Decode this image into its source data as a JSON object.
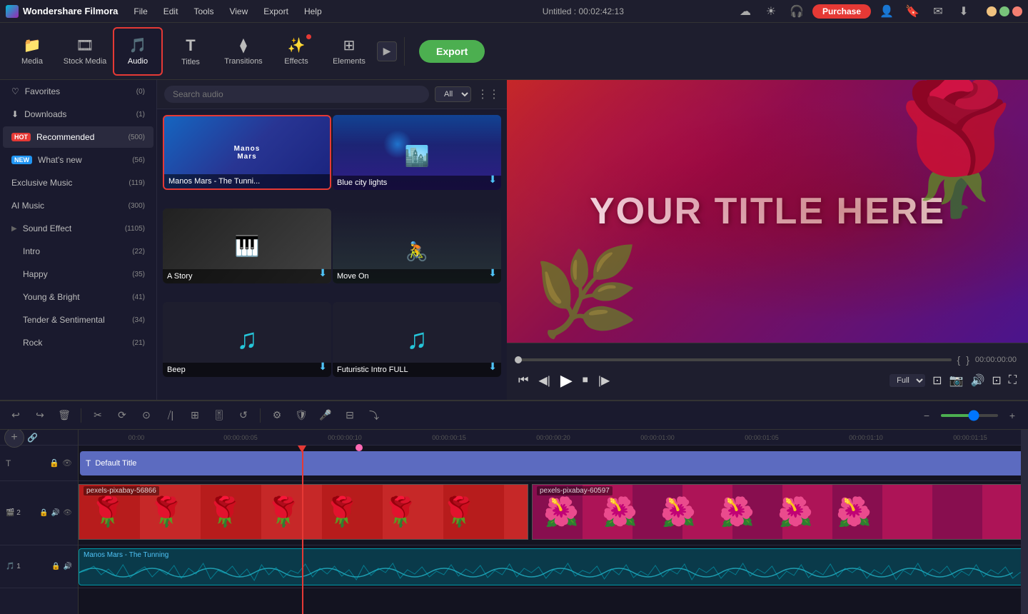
{
  "app": {
    "name": "Wondershare Filmora",
    "title": "Untitled : 00:02:42:13",
    "logo_icon": "🎬"
  },
  "titlebar": {
    "menu": [
      "File",
      "Edit",
      "Tools",
      "View",
      "Export",
      "Help"
    ],
    "purchase_label": "Purchase",
    "win_controls": [
      "minimize",
      "maximize",
      "close"
    ]
  },
  "toolbar": {
    "buttons": [
      {
        "id": "media",
        "label": "Media",
        "icon": "📁"
      },
      {
        "id": "stock",
        "label": "Stock Media",
        "icon": "🎞"
      },
      {
        "id": "audio",
        "label": "Audio",
        "icon": "🎵"
      },
      {
        "id": "titles",
        "label": "Titles",
        "icon": "T"
      },
      {
        "id": "transitions",
        "label": "Transitions",
        "icon": "⧫"
      },
      {
        "id": "effects",
        "label": "Effects",
        "icon": "✨"
      },
      {
        "id": "elements",
        "label": "Elements",
        "icon": "⊞"
      }
    ],
    "export_label": "Export"
  },
  "sidebar": {
    "items": [
      {
        "id": "favorites",
        "label": "Favorites",
        "count": "(0)",
        "icon": "♡"
      },
      {
        "id": "downloads",
        "label": "Downloads",
        "count": "(1)",
        "icon": "⬇"
      },
      {
        "id": "recommended",
        "label": "Recommended",
        "count": "(500)",
        "badge": "HOT"
      },
      {
        "id": "whatsnew",
        "label": "What's new",
        "count": "(56)",
        "badge": "NEW"
      },
      {
        "id": "exclusive",
        "label": "Exclusive Music",
        "count": "(119)"
      },
      {
        "id": "aimusic",
        "label": "AI Music",
        "count": "(300)"
      },
      {
        "id": "soundeffect",
        "label": "Sound Effect",
        "count": "(1105)",
        "hasArrow": true
      },
      {
        "id": "intro",
        "label": "Intro",
        "count": "(22)",
        "sub": true
      },
      {
        "id": "happy",
        "label": "Happy",
        "count": "(35)",
        "sub": true
      },
      {
        "id": "youngbright",
        "label": "Young & Bright",
        "count": "(41)",
        "sub": true
      },
      {
        "id": "tendersenti",
        "label": "Tender & Sentimental",
        "count": "(34)",
        "sub": true
      },
      {
        "id": "rock",
        "label": "Rock",
        "count": "(21)",
        "sub": true
      }
    ]
  },
  "audio_panel": {
    "search_placeholder": "Search audio",
    "filter_label": "All",
    "cards": [
      {
        "id": "manos",
        "label": "Manos Mars - The Tunni...",
        "type": "themed",
        "selected": true
      },
      {
        "id": "blue_city",
        "label": "Blue city lights",
        "type": "city"
      },
      {
        "id": "a_story",
        "label": "A Story",
        "type": "piano"
      },
      {
        "id": "move_on",
        "label": "Move On",
        "type": "bike"
      },
      {
        "id": "beep",
        "label": "Beep",
        "type": "note"
      },
      {
        "id": "futuristic",
        "label": "Futuristic Intro FULL",
        "type": "note"
      }
    ]
  },
  "preview": {
    "title_text": "YOUR TITLE HERE",
    "time_display": "00:00:00:00",
    "duration": "00:02:42:13",
    "quality": "Full",
    "progress": 0
  },
  "timeline": {
    "ruler_marks": [
      "00:00",
      "00:00:00:05",
      "00:00:00:10",
      "00:00:00:15",
      "00:00:00:20",
      "00:00:01:00",
      "00:00:01:05",
      "00:00:01:10",
      "00:00:01:15"
    ],
    "tracks": [
      {
        "id": "title",
        "label": "Default Title",
        "type": "title",
        "icon": "T"
      },
      {
        "id": "video1",
        "label": "pexels-pixabay-56866",
        "type": "video",
        "icon": "🖼"
      },
      {
        "id": "video2",
        "label": "pexels-pixabay-60597",
        "type": "video",
        "icon": "🖼"
      },
      {
        "id": "audio1",
        "label": "Manos Mars - The Tunning",
        "type": "audio",
        "icon": "♪"
      }
    ]
  }
}
